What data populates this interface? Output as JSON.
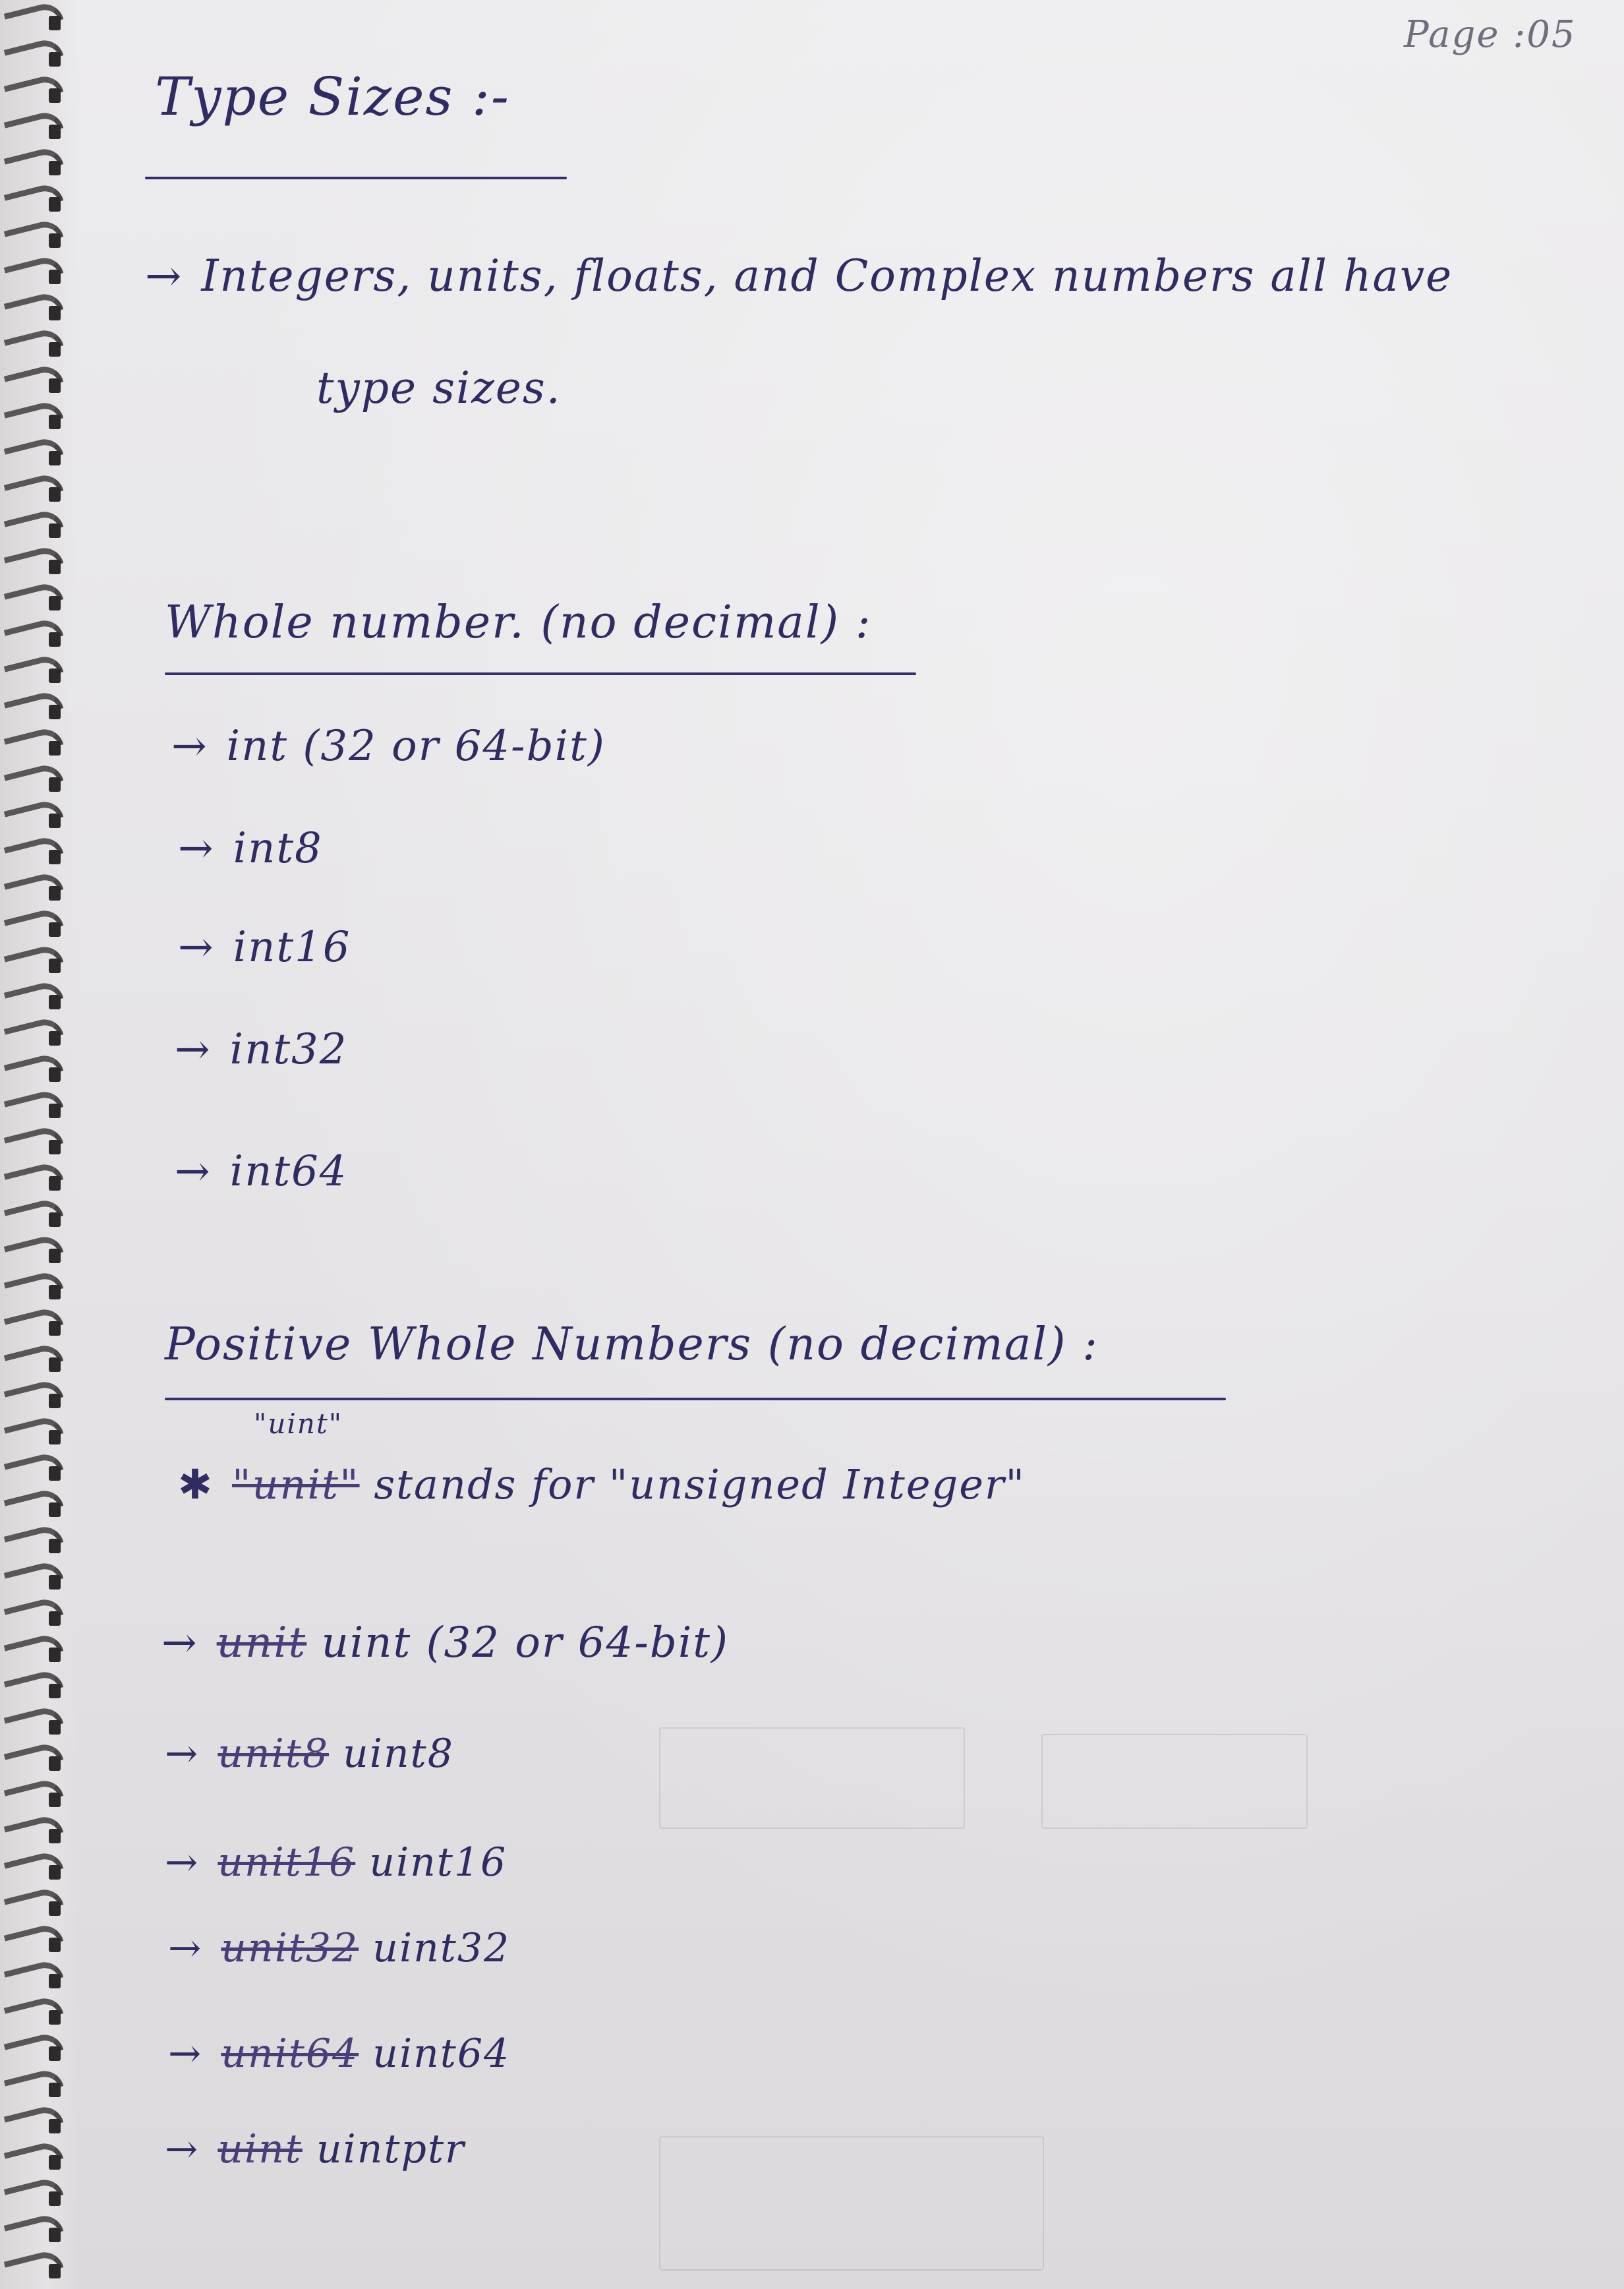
{
  "page_number": "Page :05",
  "title": "Type Sizes :-",
  "intro": {
    "line1": "Integers, units, floats, and Complex numbers all have",
    "line2": "type sizes."
  },
  "whole": {
    "heading": "Whole number. (no decimal) :",
    "items": [
      "int (32 or 64-bit)",
      "int8",
      "int16",
      "int32",
      "int64"
    ]
  },
  "positive": {
    "heading": "Positive Whole Numbers (no decimal) :",
    "note_insert": "\"uint\"",
    "note_struck": "\"unit\"",
    "note_rest": "stands for \"unsigned Integer\"",
    "items": [
      {
        "struck": "unit",
        "text": "uint (32 or 64-bit)"
      },
      {
        "struck": "unit8",
        "text": "uint8"
      },
      {
        "struck": "unit16",
        "text": "uint16"
      },
      {
        "struck": "unit32",
        "text": "uint32"
      },
      {
        "struck": "unit64",
        "text": "uint64"
      },
      {
        "struck": "uint",
        "text": "uintptr"
      }
    ]
  }
}
